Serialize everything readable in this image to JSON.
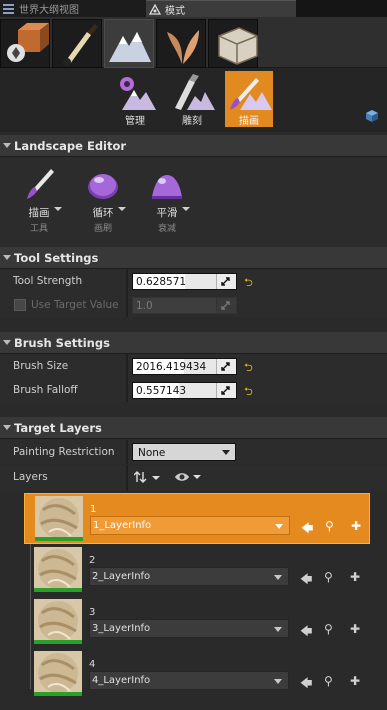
{
  "tabs": [
    {
      "label": "世界大纲视图",
      "icon": "list-icon"
    },
    {
      "label": "模式",
      "icon": "modes-icon"
    }
  ],
  "mode_buttons": [
    "place-mode-icon",
    "paint-mode-icon",
    "landscape-mode-icon",
    "foliage-mode-icon",
    "geometry-mode-icon"
  ],
  "subtools": [
    {
      "label": "管理"
    },
    {
      "label": "雕刻"
    },
    {
      "label": "描画"
    }
  ],
  "landscape_editor": {
    "title": "Landscape Editor",
    "tools": [
      {
        "label": "描画",
        "sub": "工具"
      },
      {
        "label": "循环",
        "sub": "画刷"
      },
      {
        "label": "平滑",
        "sub": "衰减"
      }
    ]
  },
  "tool_settings": {
    "title": "Tool Settings",
    "tool_strength": {
      "label": "Tool Strength",
      "value": "0.628571",
      "fraction": 0.628571
    },
    "use_target_value": {
      "label": "Use Target Value",
      "value": "1.0"
    }
  },
  "brush_settings": {
    "title": "Brush Settings",
    "brush_size": {
      "label": "Brush Size",
      "value": "2016.419434",
      "fraction": 0.62
    },
    "brush_falloff": {
      "label": "Brush Falloff",
      "value": "0.557143",
      "fraction": 0.557143
    }
  },
  "target_layers": {
    "title": "Target Layers",
    "painting_restriction": {
      "label": "Painting Restriction",
      "value": "None"
    },
    "layers_label": "Layers",
    "layers": [
      {
        "number": "1",
        "name": "1_LayerInfo"
      },
      {
        "number": "2",
        "name": "2_LayerInfo"
      },
      {
        "number": "3",
        "name": "3_LayerInfo"
      },
      {
        "number": "4",
        "name": "4_LayerInfo"
      }
    ]
  },
  "colors": {
    "accent": "#e58a1e",
    "background": "#2a2a2a",
    "section": "#383838",
    "reset": "#e0c020"
  }
}
